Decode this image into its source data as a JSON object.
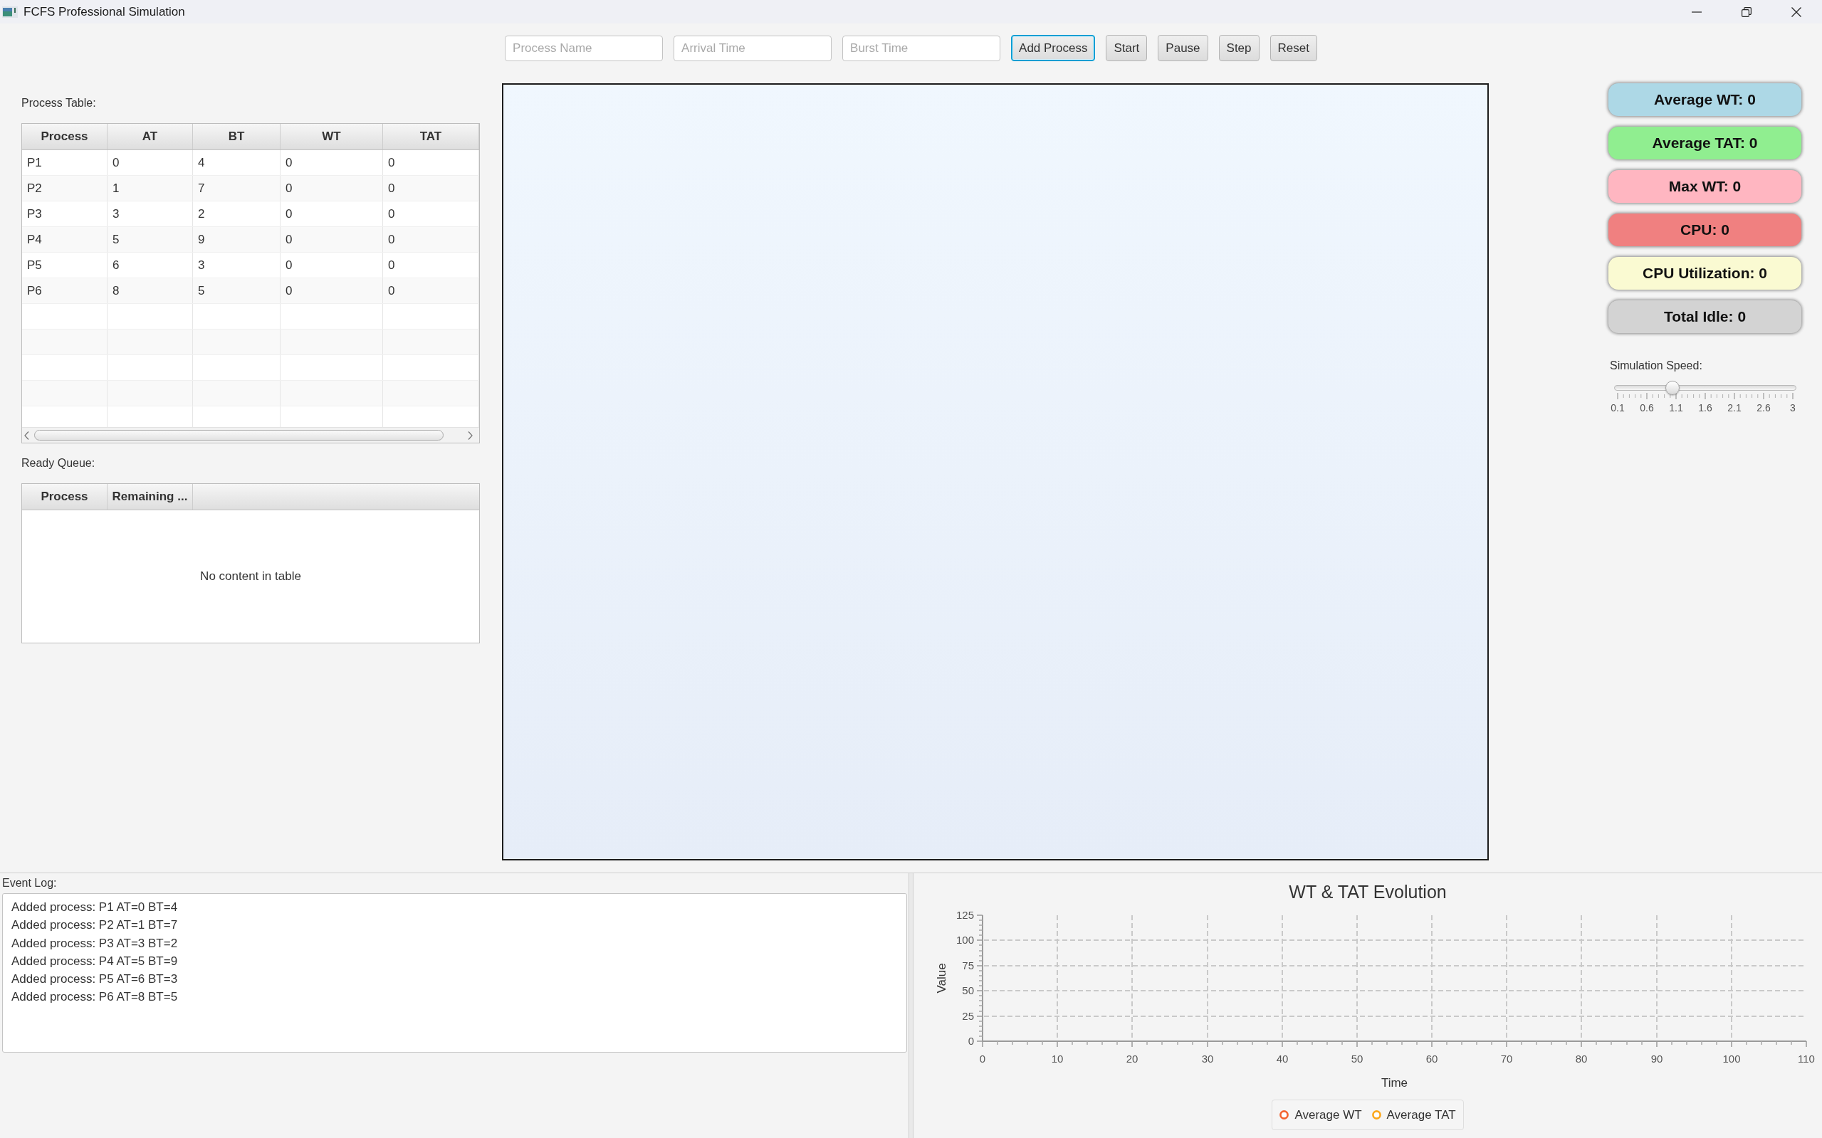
{
  "window": {
    "title": "FCFS Professional Simulation"
  },
  "toolbar": {
    "fields": [
      {
        "placeholder": "Process Name"
      },
      {
        "placeholder": "Arrival Time"
      },
      {
        "placeholder": "Burst Time"
      }
    ],
    "buttons": [
      {
        "label": "Add Process",
        "focused": true
      },
      {
        "label": "Start",
        "focused": false
      },
      {
        "label": "Pause",
        "focused": false
      },
      {
        "label": "Step",
        "focused": false
      },
      {
        "label": "Reset",
        "focused": false
      }
    ]
  },
  "process_table": {
    "label": "Process Table:",
    "columns": [
      "Process",
      "AT",
      "BT",
      "WT",
      "TAT"
    ],
    "rows": [
      [
        "P1",
        "0",
        "4",
        "0",
        "0"
      ],
      [
        "P2",
        "1",
        "7",
        "0",
        "0"
      ],
      [
        "P3",
        "3",
        "2",
        "0",
        "0"
      ],
      [
        "P4",
        "5",
        "9",
        "0",
        "0"
      ],
      [
        "P5",
        "6",
        "3",
        "0",
        "0"
      ],
      [
        "P6",
        "8",
        "5",
        "0",
        "0"
      ]
    ]
  },
  "ready_queue": {
    "label": "Ready Queue:",
    "columns": [
      "Process",
      "Remaining ..."
    ],
    "placeholder": "No content in table"
  },
  "stats": [
    {
      "label": "Average WT: 0",
      "color": "#add8e6"
    },
    {
      "label": "Average TAT: 0",
      "color": "#90ee90"
    },
    {
      "label": "Max WT: 0",
      "color": "#ffb6c1"
    },
    {
      "label": "CPU: 0",
      "color": "#f08080"
    },
    {
      "label": "CPU Utilization: 0",
      "color": "#fafad2"
    },
    {
      "label": "Total Idle: 0",
      "color": "#d3d3d3"
    }
  ],
  "speed": {
    "label": "Simulation Speed:",
    "level": 0.31,
    "ticks": [
      "0.1",
      "0.6",
      "1.1",
      "1.6",
      "2.1",
      "2.6",
      "3"
    ]
  },
  "event_log": {
    "label": "Event Log:",
    "lines": [
      "Added process: P1 AT=0 BT=4",
      "Added process: P2 AT=1 BT=7",
      "Added process: P3 AT=3 BT=2",
      "Added process: P4 AT=5 BT=9",
      "Added process: P5 AT=6 BT=3",
      "Added process: P6 AT=8 BT=5"
    ]
  },
  "chart": {
    "chart_data": {
      "type": "line",
      "title": "WT & TAT Evolution",
      "xlabel": "Time",
      "ylabel": "Value",
      "categories": [
        "0",
        "10",
        "20",
        "30",
        "40",
        "50",
        "60",
        "70",
        "80",
        "90",
        "100",
        "110"
      ],
      "ylim": [
        0,
        125
      ],
      "yticks": [
        0,
        25,
        50,
        75,
        100,
        125
      ],
      "grid": true
    },
    "legend": [
      {
        "name": "Average WT",
        "color": "#f3622d"
      },
      {
        "name": "Average TAT",
        "color": "#fba71b"
      }
    ]
  }
}
